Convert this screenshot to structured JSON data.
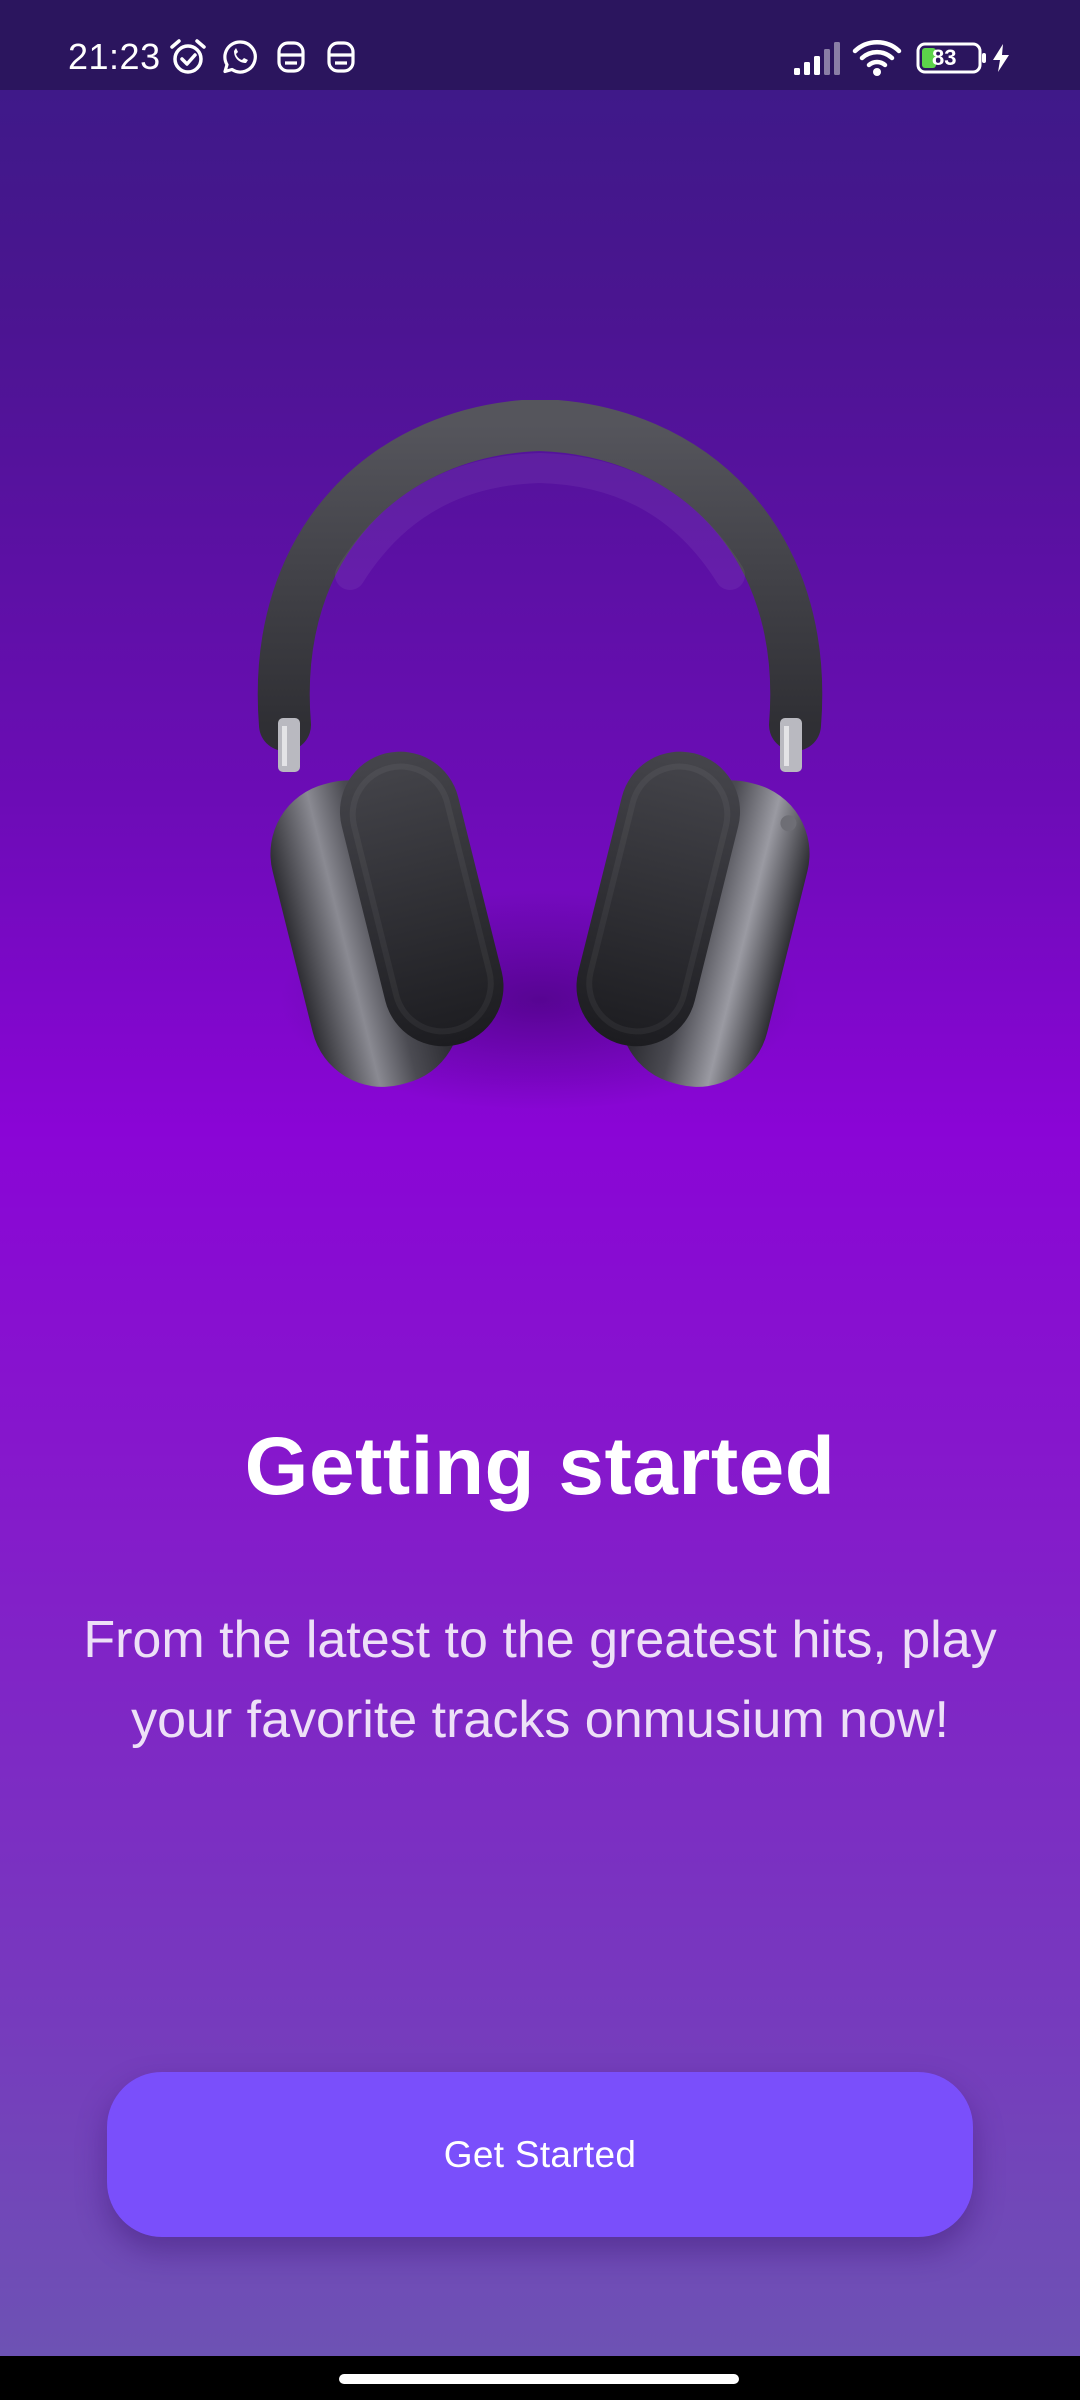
{
  "status_bar": {
    "time": "21:23",
    "battery_level": "83",
    "icons": [
      "alarm-icon",
      "whatsapp-icon",
      "app-notification-icon",
      "app-notification-icon",
      "signal-icon",
      "wifi-icon",
      "battery-icon",
      "charging-icon"
    ]
  },
  "onboarding": {
    "title": "Getting started",
    "description": "From the latest to the greatest hits, play your favorite tracks onmusium now!",
    "cta_label": "Get Started"
  },
  "colors": {
    "background_top": "#3a1b86",
    "background_mid": "#8a05d6",
    "background_bottom": "#6d52b4",
    "button": "#7a4ffb",
    "status_bar": "#2b155e"
  }
}
